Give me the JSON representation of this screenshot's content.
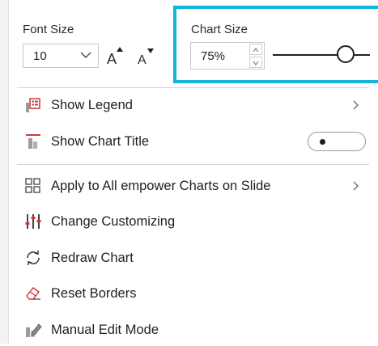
{
  "font_size": {
    "label": "Font Size",
    "value": "10",
    "increase_glyph": "A",
    "decrease_glyph": "A"
  },
  "chart_size": {
    "label": "Chart Size",
    "value": "75%",
    "slider_level_percent": 75,
    "highlight_color": "#12b6d9"
  },
  "menu": {
    "show_legend": {
      "label": "Show Legend",
      "icon": "legend-icon",
      "has_submenu": true
    },
    "show_chart_title": {
      "label": "Show Chart Title",
      "icon": "chart-title-icon",
      "toggle_on": false
    },
    "apply_all": {
      "label": "Apply to All empower Charts on Slide",
      "icon": "grid-icon",
      "has_submenu": true
    },
    "change_customizing": {
      "label": "Change Customizing",
      "icon": "customize-icon"
    },
    "redraw_chart": {
      "label": "Redraw Chart",
      "icon": "redraw-icon"
    },
    "reset_borders": {
      "label": "Reset Borders",
      "icon": "eraser-icon"
    },
    "manual_edit": {
      "label": "Manual Edit Mode",
      "icon": "manual-edit-icon"
    }
  }
}
